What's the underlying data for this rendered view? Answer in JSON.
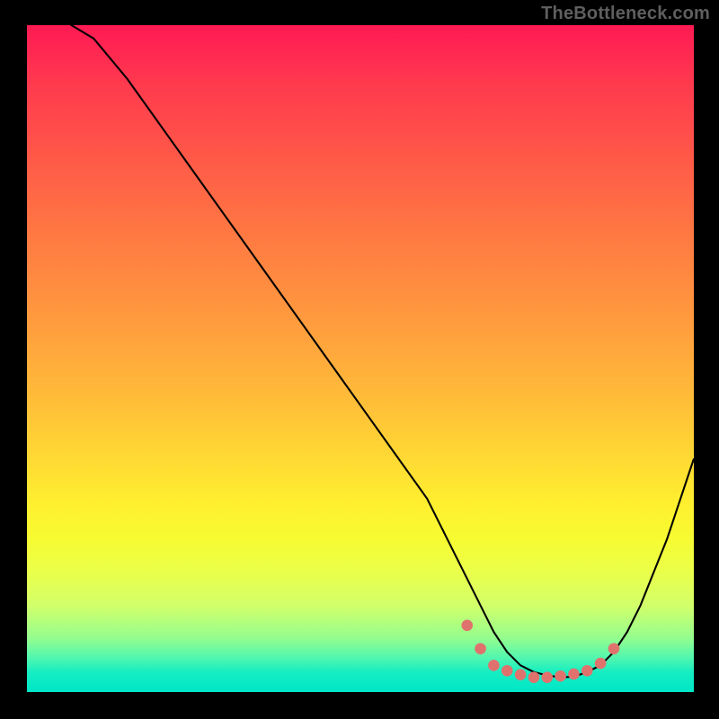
{
  "watermark": {
    "text": "TheBottleneck.com"
  },
  "colors": {
    "background": "#000000",
    "curve_stroke": "#000000",
    "dot_fill": "#e0726e",
    "watermark_text": "#5f5f5f"
  },
  "chart_data": {
    "type": "line",
    "title": "",
    "xlabel": "",
    "ylabel": "",
    "xlim": [
      0,
      100
    ],
    "ylim": [
      0,
      100
    ],
    "grid": false,
    "series": [
      {
        "name": "bottleneck-curve",
        "x": [
          0,
          5,
          10,
          15,
          20,
          25,
          30,
          35,
          40,
          45,
          50,
          55,
          60,
          64,
          68,
          70,
          72,
          74,
          76,
          78,
          80,
          82,
          84,
          86,
          88,
          90,
          92,
          94,
          96,
          98,
          100
        ],
        "values": [
          103,
          101,
          98,
          92,
          85,
          78,
          71,
          64,
          57,
          50,
          43,
          36,
          29,
          21,
          13,
          9,
          6,
          4,
          3,
          2.5,
          2.2,
          2.3,
          3,
          4,
          6,
          9,
          13,
          18,
          23,
          29,
          35
        ]
      },
      {
        "name": "optimal-range-dots",
        "x": [
          66,
          68,
          70,
          72,
          74,
          76,
          78,
          80,
          82,
          84,
          86,
          88
        ],
        "values": [
          10,
          6.5,
          4,
          3.2,
          2.6,
          2.2,
          2.2,
          2.4,
          2.7,
          3.2,
          4.3,
          6.5
        ]
      }
    ]
  }
}
